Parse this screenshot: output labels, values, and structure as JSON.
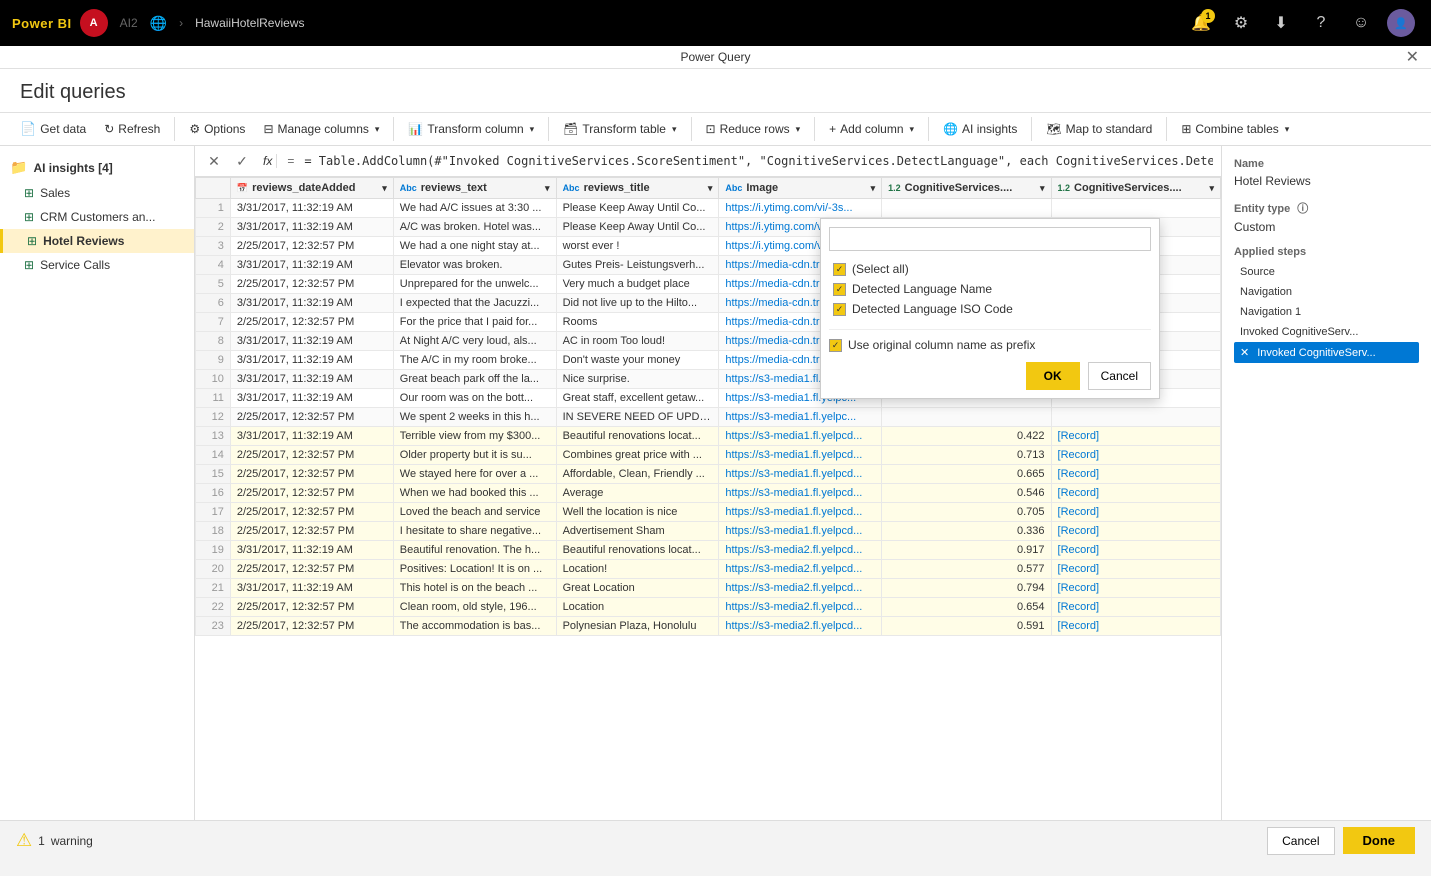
{
  "topbar": {
    "logo": "Power BI",
    "user_initials": "A",
    "user_label": "AI2",
    "breadcrumb": [
      "AI2",
      ">",
      "HawaiiHotelReviews"
    ],
    "notification_count": "1"
  },
  "powerquery_title": "Power Query",
  "close_label": "✕",
  "edit_queries_title": "Edit queries",
  "toolbar": {
    "get_data": "Get data",
    "refresh": "Refresh",
    "options": "Options",
    "manage_columns": "Manage columns",
    "transform_column": "Transform column",
    "transform_table": "Transform table",
    "reduce_rows": "Reduce rows",
    "add_column": "Add column",
    "ai_insights": "AI insights",
    "map_to_standard": "Map to standard",
    "combine_tables": "Combine tables"
  },
  "formula_bar": {
    "formula": "= Table.AddColumn(#\"Invoked CognitiveServices.ScoreSentiment\", \"CognitiveServices.DetectLanguage\", each CognitiveServices.DetectLangua..."
  },
  "sidebar": {
    "group_label": "AI insights [4]",
    "items": [
      {
        "label": "Sales",
        "type": "table"
      },
      {
        "label": "CRM Customers an...",
        "type": "table"
      },
      {
        "label": "Hotel Reviews",
        "type": "table",
        "active": true
      },
      {
        "label": "Service Calls",
        "type": "table"
      }
    ]
  },
  "table": {
    "columns": [
      {
        "name": "reviews_dateAdded",
        "type": "date"
      },
      {
        "name": "reviews_text",
        "type": "text"
      },
      {
        "name": "reviews_title",
        "type": "text"
      },
      {
        "name": "Image",
        "type": "text"
      },
      {
        "name": "CognitiveServices....",
        "type": "num"
      },
      {
        "name": "CognitiveServices....",
        "type": "num"
      }
    ],
    "rows": [
      {
        "num": 1,
        "date": "3/31/2017, 11:32:19 AM",
        "text": "We had A/C issues at 3:30 ...",
        "title": "Please Keep Away Until Co...",
        "image": "https://i.ytimg.com/vi/-3s...",
        "col5": "",
        "col6": ""
      },
      {
        "num": 2,
        "date": "3/31/2017, 11:32:19 AM",
        "text": "A/C was broken. Hotel was...",
        "title": "Please Keep Away Until Co...",
        "image": "https://i.ytimg.com/vi/gV...",
        "col5": "",
        "col6": ""
      },
      {
        "num": 3,
        "date": "2/25/2017, 12:32:57 PM",
        "text": "We had a one night stay at...",
        "title": "worst ever !",
        "image": "https://i.ytimg.com/vi/xc8...",
        "col5": "",
        "col6": ""
      },
      {
        "num": 4,
        "date": "3/31/2017, 11:32:19 AM",
        "text": "Elevator was broken.",
        "title": "Gutes Preis- Leistungsverh...",
        "image": "https://media-cdn.tripadv...",
        "col5": "",
        "col6": ""
      },
      {
        "num": 5,
        "date": "2/25/2017, 12:32:57 PM",
        "text": "Unprepared for the unwelc...",
        "title": "Very much a budget place",
        "image": "https://media-cdn.tripadv...",
        "col5": "",
        "col6": ""
      },
      {
        "num": 6,
        "date": "3/31/2017, 11:32:19 AM",
        "text": "I expected that the Jacuzzi...",
        "title": "Did not live up to the Hilto...",
        "image": "https://media-cdn.tripadv...",
        "col5": "",
        "col6": ""
      },
      {
        "num": 7,
        "date": "2/25/2017, 12:32:57 PM",
        "text": "For the price that I paid for...",
        "title": "Rooms",
        "image": "https://media-cdn.tripadv...",
        "col5": "",
        "col6": ""
      },
      {
        "num": 8,
        "date": "3/31/2017, 11:32:19 AM",
        "text": "At Night A/C very loud, als...",
        "title": "AC in room Too loud!",
        "image": "https://media-cdn.tripadv...",
        "col5": "",
        "col6": ""
      },
      {
        "num": 9,
        "date": "3/31/2017, 11:32:19 AM",
        "text": "The A/C in my room broke...",
        "title": "Don't waste your money",
        "image": "https://media-cdn.tripadv...",
        "col5": "",
        "col6": ""
      },
      {
        "num": 10,
        "date": "3/31/2017, 11:32:19 AM",
        "text": "Great beach park off the la...",
        "title": "Nice surprise.",
        "image": "https://s3-media1.fl.yelp...",
        "col5": "",
        "col6": ""
      },
      {
        "num": 11,
        "date": "3/31/2017, 11:32:19 AM",
        "text": "Our room was on the bott...",
        "title": "Great staff, excellent getaw...",
        "image": "https://s3-media1.fl.yelpc...",
        "col5": "",
        "col6": ""
      },
      {
        "num": 12,
        "date": "2/25/2017, 12:32:57 PM",
        "text": "We spent 2 weeks in this h...",
        "title": "IN SEVERE NEED OF UPDA...",
        "image": "https://s3-media1.fl.yelpc...",
        "col5": "",
        "col6": ""
      },
      {
        "num": 13,
        "date": "3/31/2017, 11:32:19 AM",
        "text": "Terrible view from my $300...",
        "title": "Beautiful renovations locat...",
        "image": "https://s3-media1.fl.yelpcd...",
        "col5": "0.422",
        "col6": "[Record]",
        "highlighted": true
      },
      {
        "num": 14,
        "date": "2/25/2017, 12:32:57 PM",
        "text": "Older property but it is su...",
        "title": "Combines great price with ...",
        "image": "https://s3-media1.fl.yelpcd...",
        "col5": "0.713",
        "col6": "[Record]",
        "highlighted": true
      },
      {
        "num": 15,
        "date": "2/25/2017, 12:32:57 PM",
        "text": "We stayed here for over a ...",
        "title": "Affordable, Clean, Friendly ...",
        "image": "https://s3-media1.fl.yelpcd...",
        "col5": "0.665",
        "col6": "[Record]",
        "highlighted": true
      },
      {
        "num": 16,
        "date": "2/25/2017, 12:32:57 PM",
        "text": "When we had booked this ...",
        "title": "Average",
        "image": "https://s3-media1.fl.yelpcd...",
        "col5": "0.546",
        "col6": "[Record]",
        "highlighted": true
      },
      {
        "num": 17,
        "date": "2/25/2017, 12:32:57 PM",
        "text": "Loved the beach and service",
        "title": "Well the location is nice",
        "image": "https://s3-media1.fl.yelpcd...",
        "col5": "0.705",
        "col6": "[Record]",
        "highlighted": true
      },
      {
        "num": 18,
        "date": "2/25/2017, 12:32:57 PM",
        "text": "I hesitate to share negative...",
        "title": "Advertisement Sham",
        "image": "https://s3-media1.fl.yelpcd...",
        "col5": "0.336",
        "col6": "[Record]",
        "highlighted": true
      },
      {
        "num": 19,
        "date": "3/31/2017, 11:32:19 AM",
        "text": "Beautiful renovation. The h...",
        "title": "Beautiful renovations locat...",
        "image": "https://s3-media2.fl.yelpcd...",
        "col5": "0.917",
        "col6": "[Record]",
        "highlighted": true
      },
      {
        "num": 20,
        "date": "2/25/2017, 12:32:57 PM",
        "text": "Positives: Location! It is on ...",
        "title": "Location!",
        "image": "https://s3-media2.fl.yelpcd...",
        "col5": "0.577",
        "col6": "[Record]",
        "highlighted": true
      },
      {
        "num": 21,
        "date": "3/31/2017, 11:32:19 AM",
        "text": "This hotel is on the beach ...",
        "title": "Great Location",
        "image": "https://s3-media2.fl.yelpcd...",
        "col5": "0.794",
        "col6": "[Record]",
        "highlighted": true
      },
      {
        "num": 22,
        "date": "2/25/2017, 12:32:57 PM",
        "text": "Clean room, old style, 196...",
        "title": "Location",
        "image": "https://s3-media2.fl.yelpcd...",
        "col5": "0.654",
        "col6": "[Record]",
        "highlighted": true
      },
      {
        "num": 23,
        "date": "2/25/2017, 12:32:57 PM",
        "text": "The accommodation is bas...",
        "title": "Polynesian Plaza, Honolulu",
        "image": "https://s3-media2.fl.yelpcd...",
        "col5": "0.591",
        "col6": "[Record]",
        "highlighted": true
      }
    ]
  },
  "dropdown": {
    "search_placeholder": "",
    "items": [
      {
        "label": "(Select all)",
        "checked": true
      },
      {
        "label": "Detected Language Name",
        "checked": true
      },
      {
        "label": "Detected Language ISO Code",
        "checked": true
      }
    ],
    "prefix_label": "Use original column name as prefix",
    "prefix_checked": true,
    "ok_label": "OK",
    "cancel_label": "Cancel"
  },
  "right_panel": {
    "name_label": "Name",
    "name_value": "Hotel Reviews",
    "entity_type_label": "Entity type",
    "entity_type_info": "ⓘ",
    "entity_type_value": "Custom",
    "applied_steps_label": "Applied steps",
    "steps": [
      {
        "label": "Source",
        "active": false,
        "error": false
      },
      {
        "label": "Navigation",
        "active": false,
        "error": false
      },
      {
        "label": "Navigation 1",
        "active": false,
        "error": false
      },
      {
        "label": "Invoked CognitiveServ...",
        "active": false,
        "error": false
      },
      {
        "label": "Invoked CognitiveServ...",
        "active": true,
        "error": true
      }
    ]
  },
  "bottom_bar": {
    "warning_count": "1",
    "warning_label": "warning",
    "cancel_label": "Cancel",
    "done_label": "Done"
  }
}
